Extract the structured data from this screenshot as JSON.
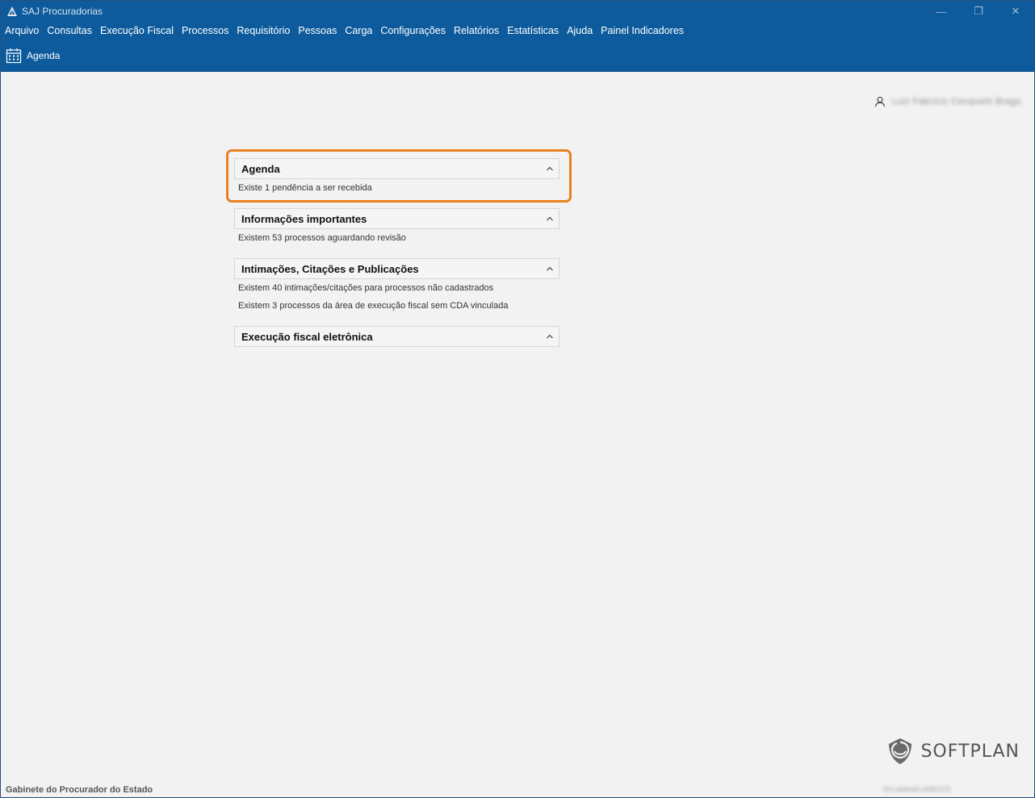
{
  "window": {
    "title": "SAJ Procuradorias",
    "controls": [
      "—",
      "❐",
      "✕"
    ]
  },
  "menu": {
    "items": [
      "Arquivo",
      "Consultas",
      "Execução Fiscal",
      "Processos",
      "Requisitório",
      "Pessoas",
      "Carga",
      "Configurações",
      "Relatórios",
      "Estatísticas",
      "Ajuda",
      "Painel Indicadores"
    ]
  },
  "toolbar": {
    "agenda_label": "Agenda"
  },
  "user": {
    "name": "Luiz Fabrício Cenquetti Braga"
  },
  "panels": [
    {
      "title": "Agenda",
      "lines": [
        "Existe 1 pendência a ser recebida"
      ]
    },
    {
      "title": "Informações importantes",
      "lines": [
        "Existem 53 processos aguardando revisão"
      ]
    },
    {
      "title": "Intimações, Citações e Publicações",
      "lines": [
        "Existem 40 intimações/citações para processos não cadastrados",
        "Existem 3 processos da área de execução fiscal sem CDA vinculada"
      ]
    },
    {
      "title": "Execução fiscal eletrônica",
      "lines": []
    }
  ],
  "footer": {
    "left": "Gabinete do Procurador do Estado",
    "right": "hm.sadsad.sddfv123"
  },
  "brand": {
    "wordmark": "SOFTPLAN"
  },
  "colors": {
    "title_bar": "#0d5b9c",
    "highlight": "#e8821e",
    "background": "#f2f2f2"
  }
}
